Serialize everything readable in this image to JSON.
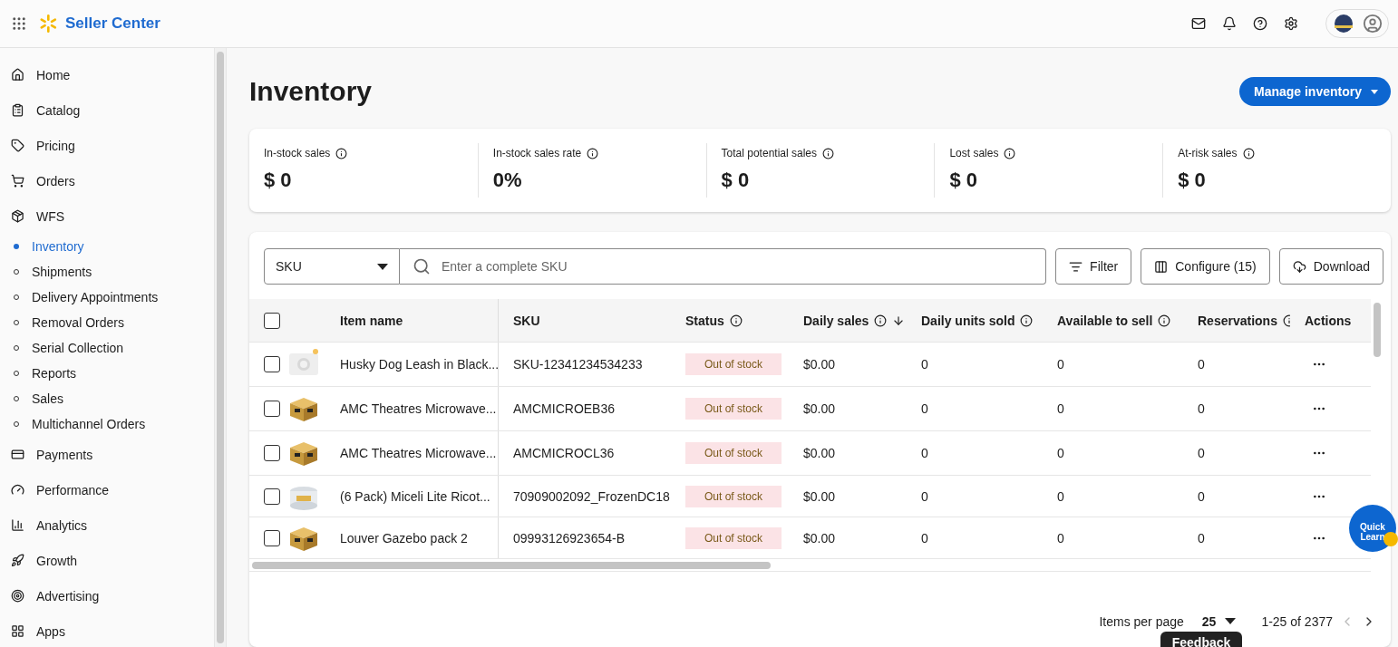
{
  "topbar": {
    "brand": "Seller Center"
  },
  "sidebar": {
    "items": [
      {
        "label": "Home",
        "selected": false
      },
      {
        "label": "Catalog",
        "selected": false
      },
      {
        "label": "Pricing",
        "selected": false
      },
      {
        "label": "Orders",
        "selected": false
      },
      {
        "label": "WFS",
        "selected": false,
        "children": [
          {
            "label": "Inventory",
            "selected": true
          },
          {
            "label": "Shipments",
            "selected": false
          },
          {
            "label": "Delivery Appointments",
            "selected": false
          },
          {
            "label": "Removal Orders",
            "selected": false
          },
          {
            "label": "Serial Collection",
            "selected": false
          },
          {
            "label": "Reports",
            "selected": false
          },
          {
            "label": "Sales",
            "selected": false
          },
          {
            "label": "Multichannel Orders",
            "selected": false
          }
        ]
      },
      {
        "label": "Payments",
        "selected": false
      },
      {
        "label": "Performance",
        "selected": false
      },
      {
        "label": "Analytics",
        "selected": false
      },
      {
        "label": "Growth",
        "selected": false
      },
      {
        "label": "Advertising",
        "selected": false
      },
      {
        "label": "Apps",
        "selected": false
      }
    ]
  },
  "page": {
    "title": "Inventory",
    "primary_button": "Manage inventory"
  },
  "stats": [
    {
      "label": "In-stock sales",
      "value": "$ 0"
    },
    {
      "label": "In-stock sales rate",
      "value": "0%"
    },
    {
      "label": "Total potential sales",
      "value": "$ 0"
    },
    {
      "label": "Lost sales",
      "value": "$ 0"
    },
    {
      "label": "At-risk sales",
      "value": "$ 0"
    }
  ],
  "toolbar": {
    "search_by": "SKU",
    "search": {
      "placeholder": "Enter a complete SKU"
    },
    "buttons": [
      {
        "label": "Filter"
      },
      {
        "label": "Configure (15)"
      },
      {
        "label": "Download"
      }
    ]
  },
  "table": {
    "select_all_checked": false,
    "columns": [
      {
        "label": "Item name",
        "info": false,
        "sorted": false
      },
      {
        "label": "SKU",
        "info": false,
        "sorted": false
      },
      {
        "label": "Status",
        "info": true,
        "sorted": false
      },
      {
        "label": "Daily sales",
        "info": true,
        "sorted": true
      },
      {
        "label": "Daily units sold",
        "info": true,
        "sorted": false
      },
      {
        "label": "Available to sell",
        "info": true,
        "sorted": false
      },
      {
        "label": "Reservations",
        "info": true,
        "sorted": false
      },
      {
        "label": "Actions",
        "info": false,
        "sorted": false
      }
    ],
    "rows": [
      {
        "checked": false,
        "item_name": "Husky Dog Leash in Black...",
        "sku": "SKU-12341234534233",
        "status": "Out of stock",
        "daily_sales": "$0.00",
        "daily_units_sold": "0",
        "available_to_sell": "0",
        "reservations": "0"
      },
      {
        "checked": false,
        "item_name": "AMC Theatres Microwave...",
        "sku": "AMCMICROEB36",
        "status": "Out of stock",
        "daily_sales": "$0.00",
        "daily_units_sold": "0",
        "available_to_sell": "0",
        "reservations": "0"
      },
      {
        "checked": false,
        "item_name": "AMC Theatres Microwave...",
        "sku": "AMCMICROCL36",
        "status": "Out of stock",
        "daily_sales": "$0.00",
        "daily_units_sold": "0",
        "available_to_sell": "0",
        "reservations": "0"
      },
      {
        "checked": false,
        "item_name": "(6 Pack) Miceli Lite Ricot...",
        "sku": "70909002092_FrozenDC18",
        "status": "Out of stock",
        "daily_sales": "$0.00",
        "daily_units_sold": "0",
        "available_to_sell": "0",
        "reservations": "0"
      },
      {
        "checked": false,
        "item_name": "Louver Gazebo pack 2",
        "sku": "09993126923654-B",
        "status": "Out of stock",
        "daily_sales": "$0.00",
        "daily_units_sold": "0",
        "available_to_sell": "0",
        "reservations": "0"
      }
    ]
  },
  "pagination": {
    "label": "Items per page",
    "per_page": "25",
    "range": "1-25 of 2377",
    "prev_disabled": true,
    "next_disabled": false
  },
  "feedback": "Feedback",
  "quick_learn": {
    "lines": [
      "Quick",
      "Learn"
    ]
  }
}
